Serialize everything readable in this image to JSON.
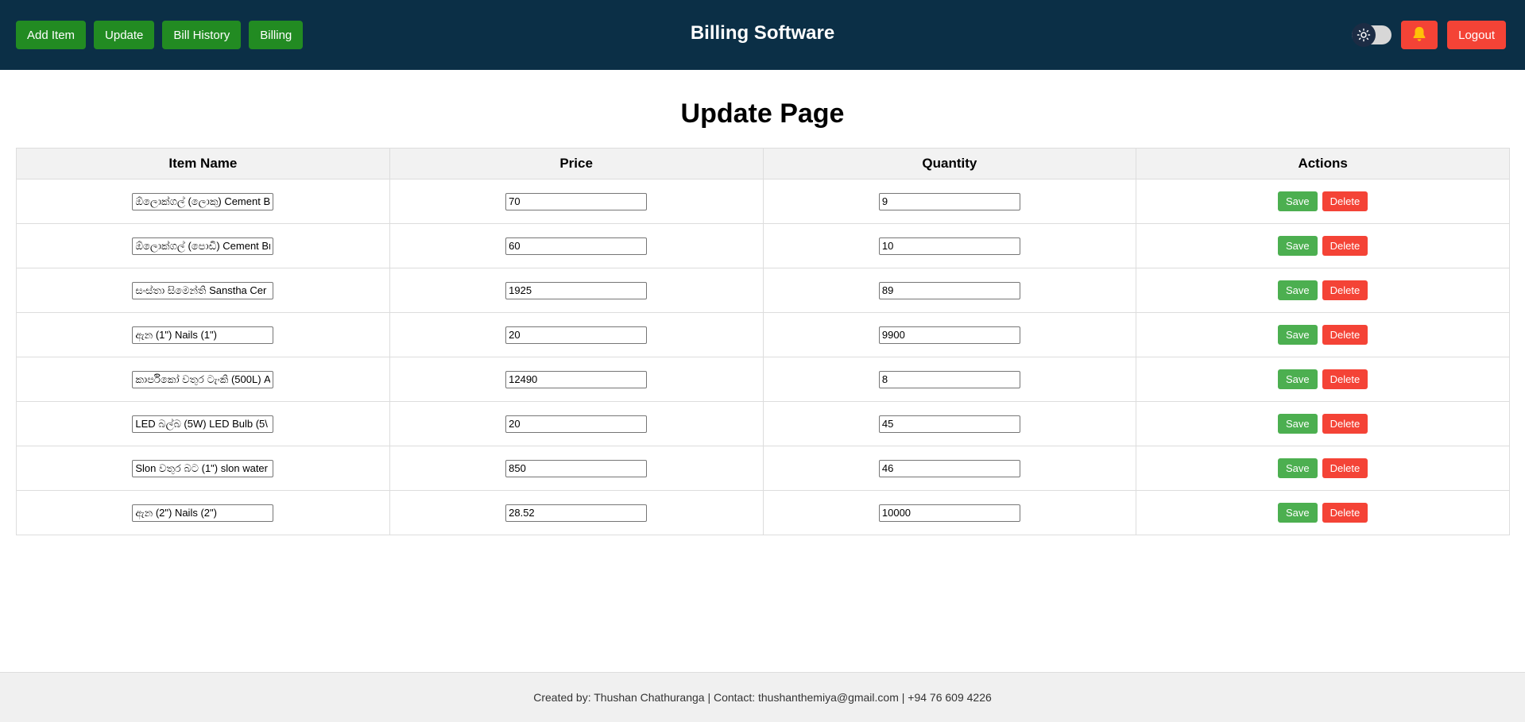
{
  "nav": {
    "buttons": [
      "Add Item",
      "Update",
      "Bill History",
      "Billing"
    ],
    "app_title": "Billing Software",
    "logout_label": "Logout",
    "theme_icon": "sun-icon",
    "bell_icon": "bell-icon"
  },
  "page": {
    "title": "Update Page"
  },
  "table": {
    "headers": [
      "Item Name",
      "Price",
      "Quantity",
      "Actions"
    ],
    "rows": [
      {
        "name": "ඕලොක්ගල් (ලොකු) Cement B",
        "price": "70",
        "quantity": "9"
      },
      {
        "name": "ඕලොක්ගල් (පොඩි) Cement Br",
        "price": "60",
        "quantity": "10"
      },
      {
        "name": "සංස්තා සිමෙන්ති Sanstha Cer",
        "price": "1925",
        "quantity": "89"
      },
      {
        "name": "ඇන (1\") Nails (1\")",
        "price": "20",
        "quantity": "9900"
      },
      {
        "name": "කාර්පිකෝ වතුර ටැංකි (500L) A",
        "price": "12490",
        "quantity": "8"
      },
      {
        "name": "LED බල්බ (5W) LED Bulb (5\\",
        "price": "20",
        "quantity": "45"
      },
      {
        "name": "Slon වතුර බට (1\") slon water",
        "price": "850",
        "quantity": "46"
      },
      {
        "name": "ඇන (2\") Nails (2\")",
        "price": "28.52",
        "quantity": "10000"
      }
    ],
    "save_label": "Save",
    "delete_label": "Delete"
  },
  "footer": {
    "text": "Created by: Thushan Chathuranga | Contact: thushanthemiya@gmail.com | +94 76 609 4226"
  },
  "colors": {
    "header_bg": "#0b2f46",
    "nav_button": "#228b22",
    "danger": "#f44336",
    "save": "#4caf50"
  }
}
